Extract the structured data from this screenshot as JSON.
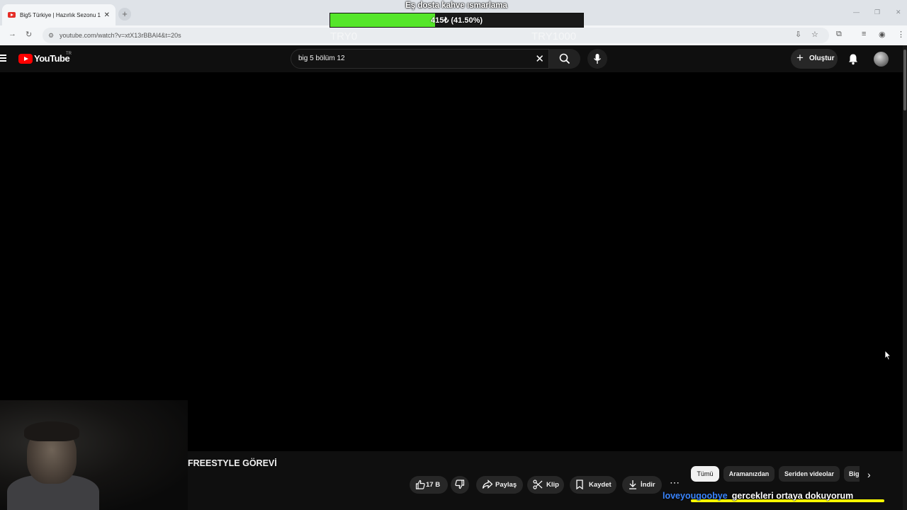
{
  "browser": {
    "tab_title": "Big5 Türkiye | Hazırlık Sezonu 1",
    "tab_close": "✕",
    "new_tab": "+",
    "url": "youtube.com/watch?v=xtX13rBBAl4&t=20s"
  },
  "donation_goal": {
    "title": "Eş dosta kahve ısmarlama",
    "progress_text": "415₺ (41.50%)",
    "progress_fraction": 0.415,
    "min_label": "TRY0",
    "max_label": "TRY1000",
    "fill_color": "#55e62a"
  },
  "youtube": {
    "logo_text": "YouTube",
    "country_code": "TR",
    "search_query": "big 5 bölüm 12",
    "create_label": "Oluştur",
    "video_title": "FREESTYLE GÖREVİ",
    "actions": {
      "like_count": "17 B",
      "share": "Paylaş",
      "clip": "Klip",
      "save": "Kaydet",
      "download": "İndir"
    },
    "chips": [
      "Tümü",
      "Aramanızdan",
      "Seriden videolar",
      "Big"
    ]
  },
  "stream_chat": {
    "username": "loveyougoobye",
    "message": "gercekleri ortaya dokuyorum"
  }
}
